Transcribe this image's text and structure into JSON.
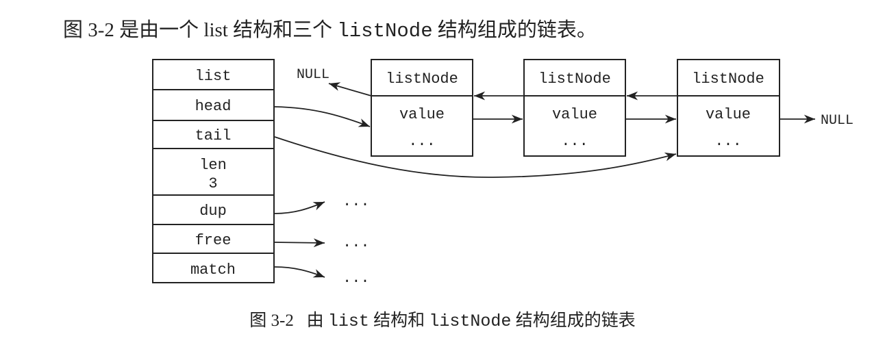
{
  "paragraph": {
    "prefix": "图 3-2 是由一个 list 结构和三个 ",
    "code": "listNode",
    "suffix": " 结构组成的链表。"
  },
  "list_struct": {
    "fields": [
      {
        "label": "list"
      },
      {
        "label": "head"
      },
      {
        "label": "tail"
      },
      {
        "label": "len",
        "value": "3"
      },
      {
        "label": "dup"
      },
      {
        "label": "free"
      },
      {
        "label": "match"
      }
    ]
  },
  "nodes": [
    {
      "title": "listNode",
      "value": "value",
      "more": "..."
    },
    {
      "title": "listNode",
      "value": "value",
      "more": "..."
    },
    {
      "title": "listNode",
      "value": "value",
      "more": "..."
    }
  ],
  "null_left": "NULL",
  "null_right": "NULL",
  "function_targets": [
    "...",
    "...",
    "..."
  ],
  "caption": {
    "number": "图 3-2",
    "t1": "由 ",
    "c1": "list",
    "t2": " 结构和 ",
    "c2": "listNode",
    "t3": " 结构组成的链表"
  }
}
